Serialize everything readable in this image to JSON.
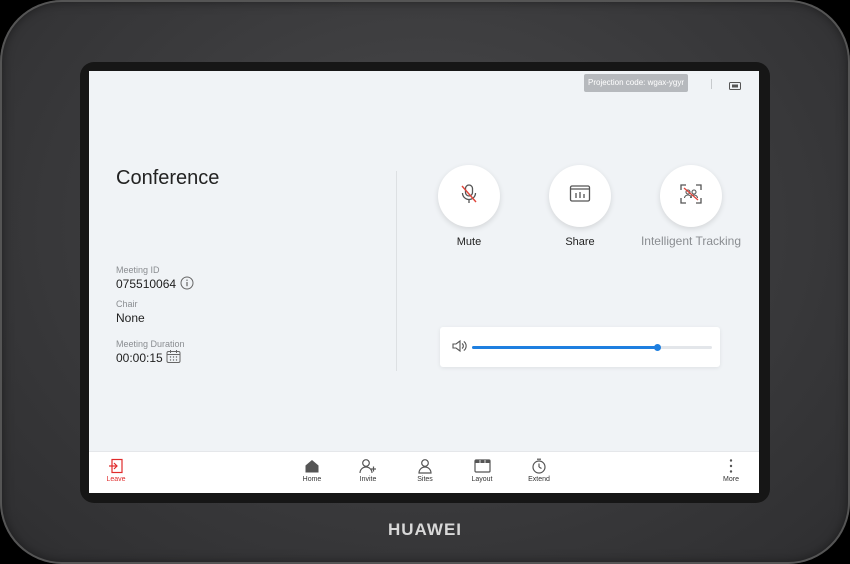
{
  "device": {
    "brand": "HUAWEI"
  },
  "topbar": {
    "projection_code": "Projection code: wgax-ygyr"
  },
  "conference": {
    "title": "Conference",
    "meeting_id_label": "Meeting ID",
    "meeting_id": "075510064",
    "chair_label": "Chair",
    "chair": "None",
    "duration_label": "Meeting Duration",
    "duration": "00:00:15"
  },
  "controls": {
    "mute": {
      "label": "Mute",
      "icon": "microphone-off-icon"
    },
    "share": {
      "label": "Share",
      "icon": "share-screen-icon"
    },
    "tracking": {
      "label": "Intelligent Tracking",
      "icon": "tracking-icon"
    }
  },
  "volume": {
    "level": 0.77,
    "accent": "#1e7fe0"
  },
  "bottom_nav": {
    "leave": "Leave",
    "home": "Home",
    "invite": "Invite",
    "sites": "Sites",
    "layout": "Layout",
    "extend": "Extend",
    "more": "More"
  },
  "colors": {
    "leave": "#e02b2b",
    "muted_icon": "#e0453a"
  }
}
